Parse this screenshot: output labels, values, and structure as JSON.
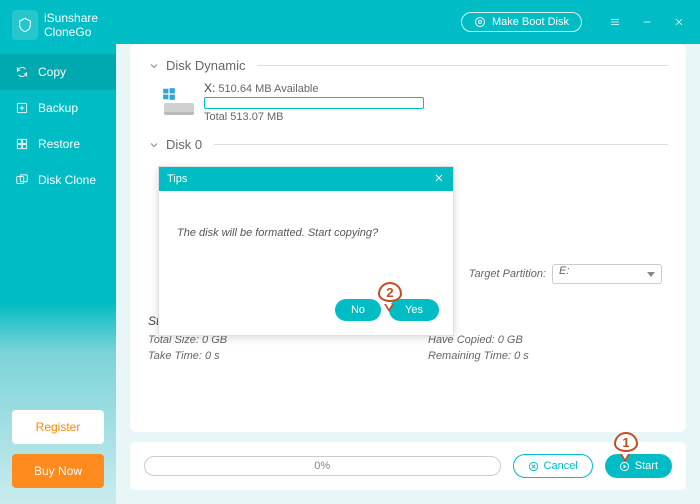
{
  "app": {
    "name_line1": "iSunshare",
    "name_line2": "CloneGo"
  },
  "sidebar": {
    "items": [
      {
        "label": "Copy",
        "icon": "refresh-icon",
        "active": true
      },
      {
        "label": "Backup",
        "icon": "plus-box-icon"
      },
      {
        "label": "Restore",
        "icon": "grid-icon"
      },
      {
        "label": "Disk Clone",
        "icon": "clone-icon"
      }
    ],
    "register": "Register",
    "buy": "Buy Now"
  },
  "titlebar": {
    "make_boot": "Make Boot Disk"
  },
  "sections": {
    "dynamic": {
      "title": "Disk Dynamic",
      "drive_label": "X:",
      "available": "510.64 MB Available",
      "total": "Total 513.07 MB"
    },
    "disk0": {
      "title": "Disk 0"
    }
  },
  "target": {
    "label": "Target Partition:",
    "value": "E:"
  },
  "status": {
    "title": "Status:",
    "total_size_label": "Total Size:",
    "total_size_value": "0 GB",
    "copied_label": "Have Copied:",
    "copied_value": "0 GB",
    "take_time_label": "Take Time:",
    "take_time_value": "0 s",
    "remaining_label": "Remaining Time:",
    "remaining_value": "0 s"
  },
  "bottom": {
    "progress": "0%",
    "cancel": "Cancel",
    "start": "Start"
  },
  "dialog": {
    "title": "Tips",
    "message": "The disk will be formatted. Start copying?",
    "no": "No",
    "yes": "Yes"
  },
  "callouts": {
    "one": "1",
    "two": "2"
  }
}
